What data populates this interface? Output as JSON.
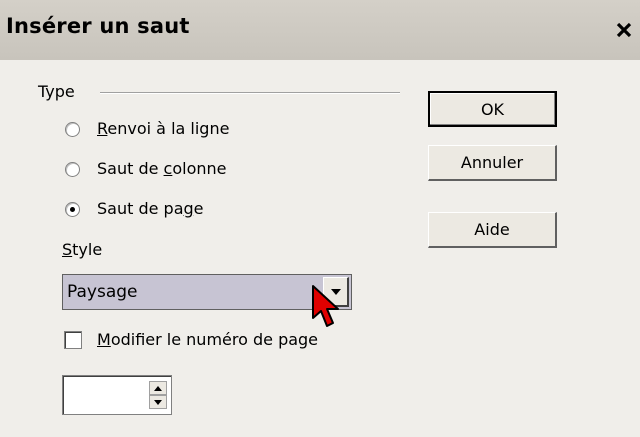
{
  "window": {
    "title": "Insérer un saut",
    "close_icon": "close-icon"
  },
  "type_group": {
    "label": "Type",
    "options": [
      {
        "label": "Renvoi à la ligne",
        "mnemonic": "R",
        "checked": false
      },
      {
        "label": "Saut de colonne",
        "mnemonic": "c",
        "checked": false
      },
      {
        "label": "Saut de page",
        "mnemonic": "g",
        "checked": true
      }
    ]
  },
  "style": {
    "label": "Style",
    "selected": "Paysage"
  },
  "modify_page_number": {
    "label": "Modifier le numéro de page",
    "checked": false
  },
  "page_number": {
    "value": ""
  },
  "buttons": {
    "ok": "OK",
    "cancel": "Annuler",
    "help": "Aide"
  },
  "cursor": {
    "icon": "mouse-pointer-icon",
    "color": "#e00000"
  }
}
